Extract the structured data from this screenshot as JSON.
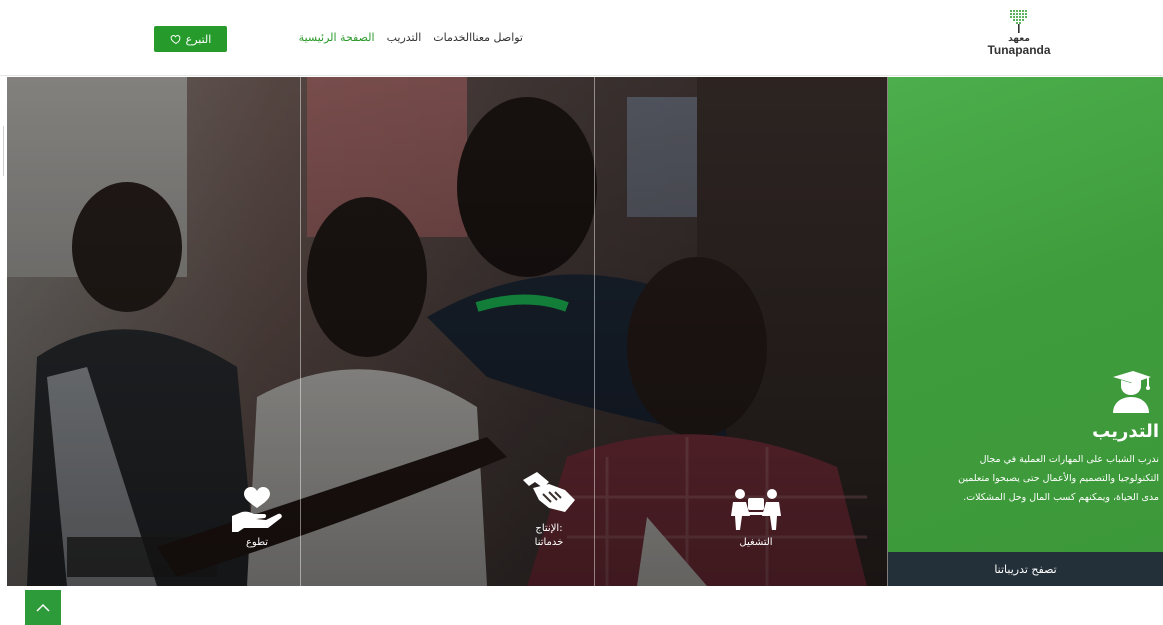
{
  "header": {
    "logo": {
      "subtitle": "معهد",
      "name": "Tunapanda",
      "icon": "dot-grid-tree-icon",
      "color": "#2b9a2b"
    },
    "nav": [
      {
        "label": "الصفحة الرئيسية",
        "active": true
      },
      {
        "label": "التدريب",
        "active": false
      },
      {
        "label": "الخدمات",
        "active": false
      },
      {
        "label": "تواصل معنا",
        "active": false
      }
    ],
    "donate": {
      "label": "التبرع",
      "icon": "heart-outline-icon",
      "color": "#269b2b"
    }
  },
  "hero": {
    "panels": [
      {
        "label": "التشغيل",
        "icon": "people-meeting-icon"
      },
      {
        "label_line1": "الإنتاج:",
        "label_line2": "خدماتنا",
        "icon": "handshake-icon"
      },
      {
        "label": "تطوع",
        "icon": "heart-hand-icon"
      }
    ],
    "training": {
      "icon": "graduate-icon",
      "title": "التدريب",
      "desc_line1": "ندرب الشباب على المهارات العملية في مجال",
      "desc_line2": "التكنولوجيا والتصميم والأعمال حتى يصبحوا متعلمين",
      "desc_line3": "مدى الحياة، ويمكنهم كسب المال وحل المشكلات.",
      "cta": "تصفح تدريباتنا",
      "panel_color": "#3f9c3c",
      "cta_color": "#23303a"
    }
  },
  "scroll_top": {
    "icon": "chevron-up-icon",
    "color": "#2e9b3a"
  }
}
